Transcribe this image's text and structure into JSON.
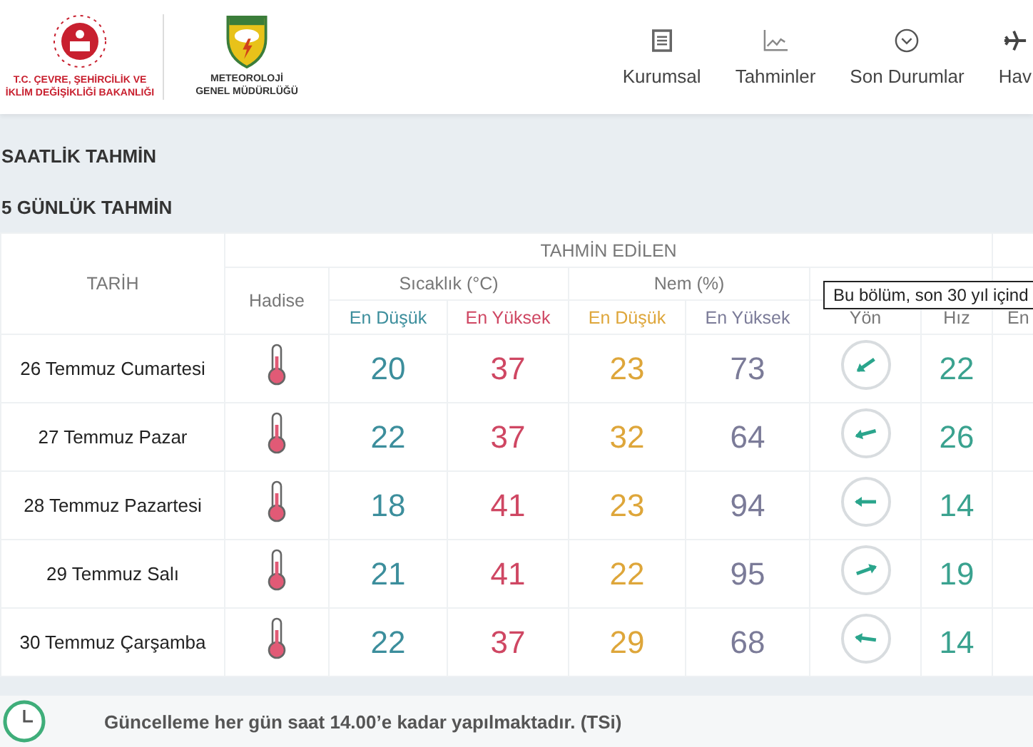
{
  "header": {
    "ministry_logo_text": [
      "T.C. ÇEVRE, ŞEHİRCİLİK VE",
      "İKLİM DEĞİŞİKLİĞİ BAKANLIĞI"
    ],
    "agency_logo_text": [
      "METEOROLOJİ",
      "GENEL MÜDÜRLÜĞÜ"
    ],
    "nav": [
      {
        "label": "Kurumsal",
        "kind": "document"
      },
      {
        "label": "Tahminler",
        "kind": "chart"
      },
      {
        "label": "Son Durumlar",
        "kind": "chevron"
      },
      {
        "label": "Hav",
        "kind": "plane"
      }
    ]
  },
  "sections": [
    "SAATLİK TAHMİN",
    "5 GÜNLÜK TAHMİN"
  ],
  "table": {
    "date_heading": "TARİH",
    "group_heading": "TAHMİN EDİLEN",
    "event_heading": "Hadise",
    "groups": [
      {
        "label": "Sıcaklık (°C)",
        "sub": [
          "En Düşük",
          "En Yüksek"
        ]
      },
      {
        "label": "Nem (%)",
        "sub": [
          "En Düşük",
          "En Yüksek"
        ]
      }
    ],
    "wind_sub": [
      "Yön",
      "Hız"
    ],
    "extra_sub": "En",
    "rows": [
      {
        "date": "26 Temmuz Cumartesi",
        "temp_min": "20",
        "temp_max": "37",
        "hum_min": "23",
        "hum_max": "73",
        "kind": "southwest",
        "wind_speed": "22"
      },
      {
        "date": "27 Temmuz Pazar",
        "temp_min": "22",
        "temp_max": "37",
        "hum_min": "32",
        "hum_max": "64",
        "kind": "westsouthwest",
        "wind_speed": "26"
      },
      {
        "date": "28 Temmuz Pazartesi",
        "temp_min": "18",
        "temp_max": "41",
        "hum_min": "23",
        "hum_max": "94",
        "kind": "west",
        "wind_speed": "14"
      },
      {
        "date": "29 Temmuz Salı",
        "temp_min": "21",
        "temp_max": "41",
        "hum_min": "22",
        "hum_max": "95",
        "kind": "eastnortheast",
        "wind_speed": "19"
      },
      {
        "date": "30 Temmuz Çarşamba",
        "temp_min": "22",
        "temp_max": "37",
        "hum_min": "29",
        "hum_max": "68",
        "kind": "westnorthwest",
        "wind_speed": "14"
      }
    ]
  },
  "tooltip": "Bu bölüm, son 30 yıl içind",
  "footer": "Güncelleme her gün saat 14.00’e kadar yapılmaktadır. (TSi)"
}
